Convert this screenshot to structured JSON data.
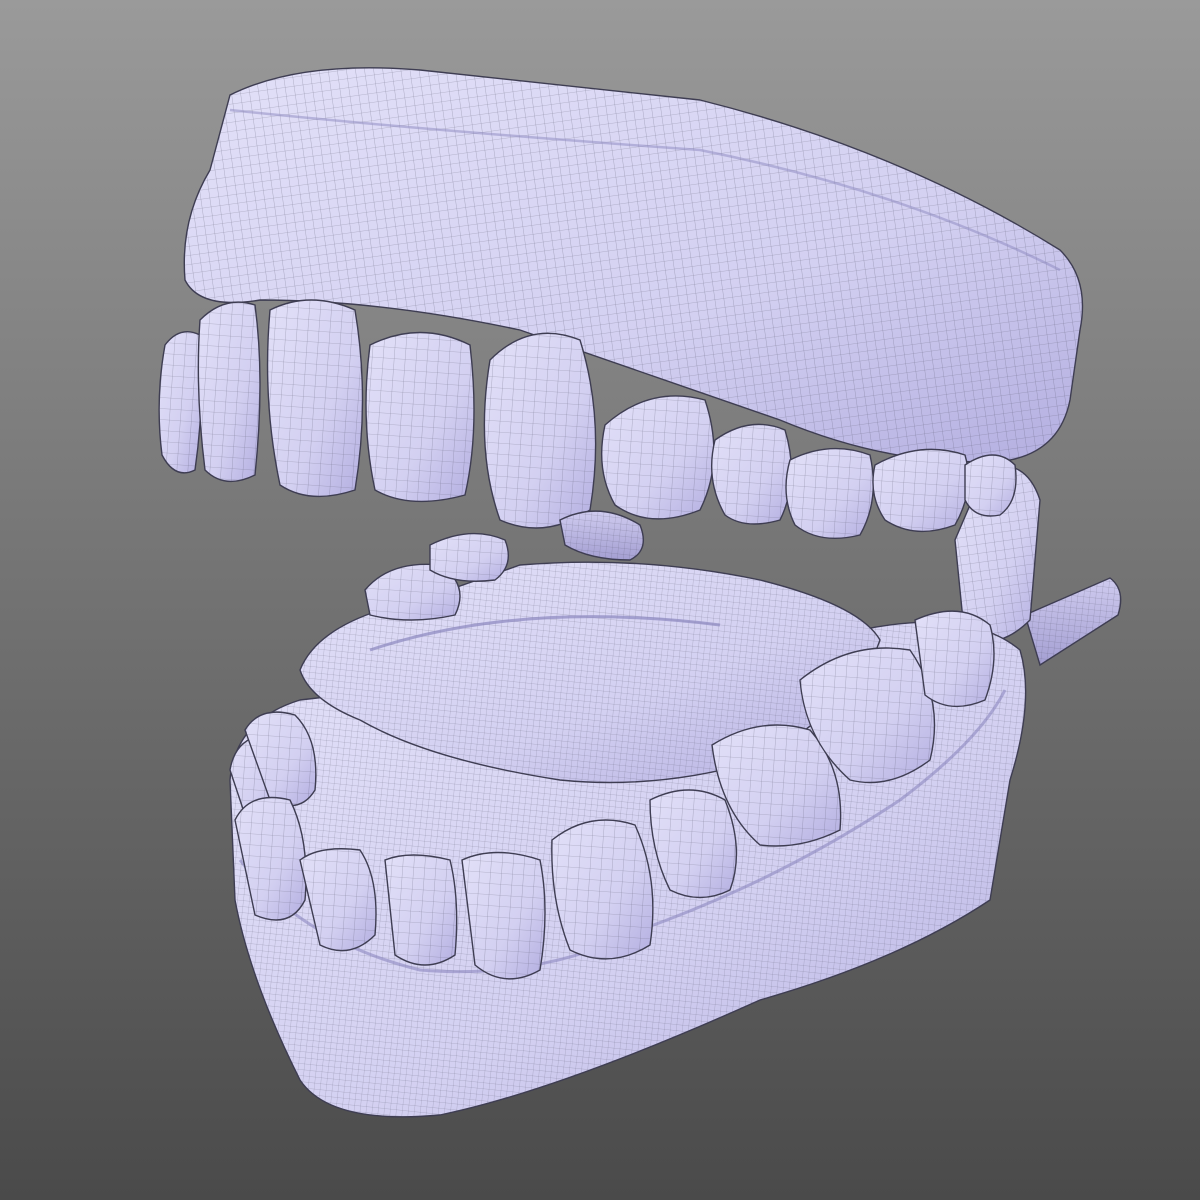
{
  "viewport": {
    "background_top": "#9a9a9a",
    "background_bottom": "#4a4a4a"
  },
  "model": {
    "name": "dental-jaw-model",
    "surface_color": "#d6d3f4",
    "surface_shadow": "#a9a4d6",
    "wireframe_color": "#4b4a5e",
    "display_mode": "shaded-wireframe"
  }
}
